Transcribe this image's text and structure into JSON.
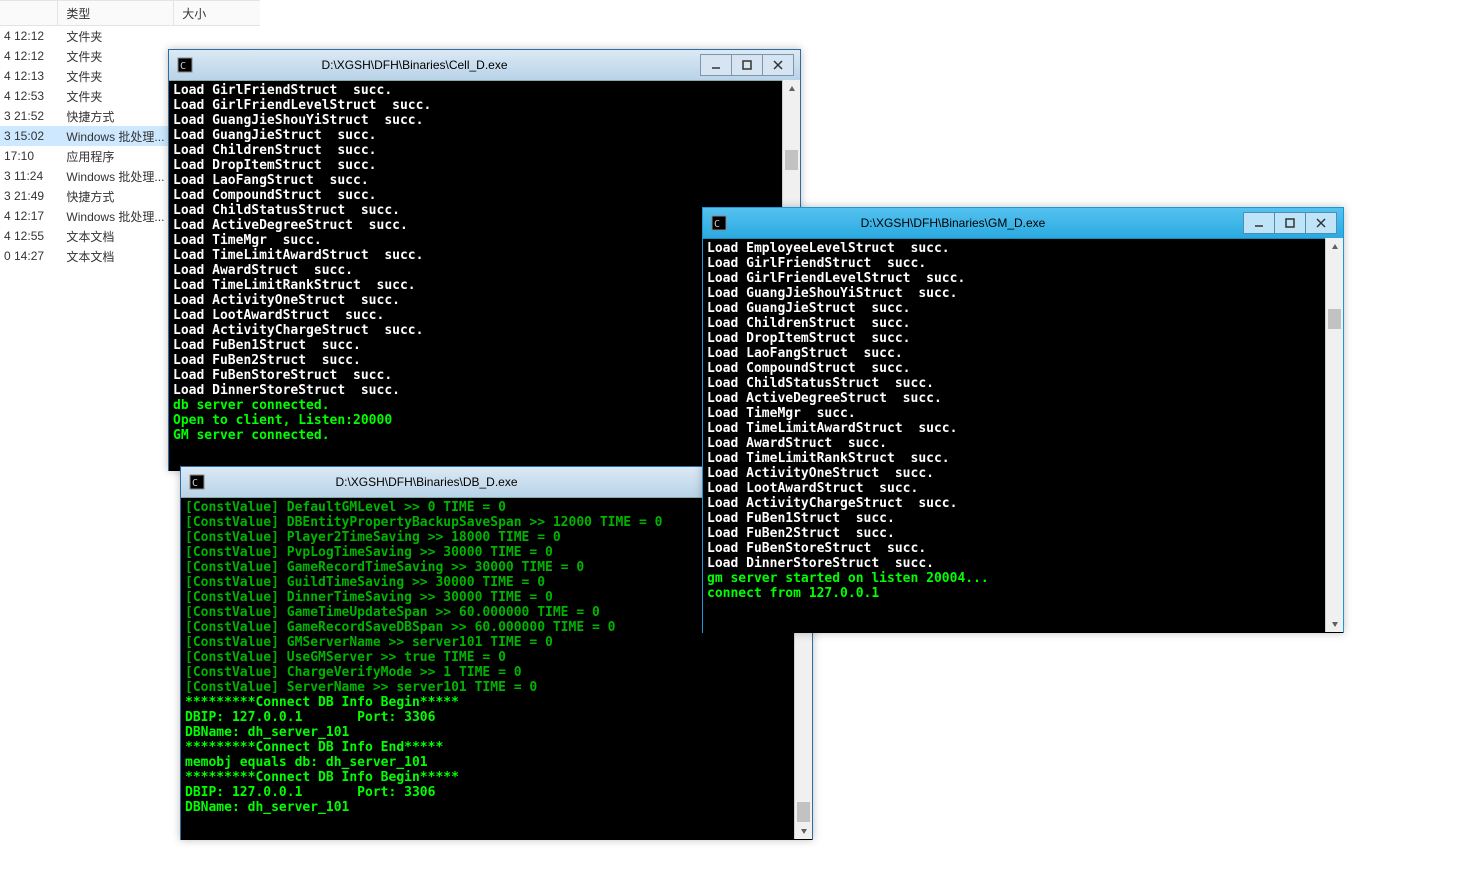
{
  "filepane": {
    "headers": {
      "type": "类型",
      "size": "大小"
    },
    "rows": [
      {
        "date": "4 12:12",
        "type": "文件夹"
      },
      {
        "date": "4 12:12",
        "type": "文件夹"
      },
      {
        "date": "4 12:13",
        "type": "文件夹"
      },
      {
        "date": "4 12:53",
        "type": "文件夹"
      },
      {
        "date": "3 21:52",
        "type": "快捷方式"
      },
      {
        "date": "3 15:02",
        "type": "Windows 批处理...",
        "selected": true
      },
      {
        "date": "17:10",
        "type": "应用程序"
      },
      {
        "date": "3 11:24",
        "type": "Windows 批处理..."
      },
      {
        "date": "3 21:49",
        "type": "快捷方式"
      },
      {
        "date": "4 12:17",
        "type": "Windows 批处理..."
      },
      {
        "date": "4 12:55",
        "type": "文本文档"
      },
      {
        "date": "0 14:27",
        "type": "文本文档"
      }
    ]
  },
  "windows": {
    "cell": {
      "title": "D:\\XGSH\\DFH\\Binaries\\Cell_D.exe",
      "lines": [
        {
          "c": "white",
          "t": "Load GirlFriendStruct  succ."
        },
        {
          "c": "white",
          "t": "Load GirlFriendLevelStruct  succ."
        },
        {
          "c": "white",
          "t": "Load GuangJieShouYiStruct  succ."
        },
        {
          "c": "white",
          "t": "Load GuangJieStruct  succ."
        },
        {
          "c": "white",
          "t": "Load ChildrenStruct  succ."
        },
        {
          "c": "white",
          "t": "Load DropItemStruct  succ."
        },
        {
          "c": "white",
          "t": "Load LaoFangStruct  succ."
        },
        {
          "c": "white",
          "t": "Load CompoundStruct  succ."
        },
        {
          "c": "white",
          "t": "Load ChildStatusStruct  succ."
        },
        {
          "c": "white",
          "t": "Load ActiveDegreeStruct  succ."
        },
        {
          "c": "white",
          "t": "Load TimeMgr  succ."
        },
        {
          "c": "white",
          "t": "Load TimeLimitAwardStruct  succ."
        },
        {
          "c": "white",
          "t": "Load AwardStruct  succ."
        },
        {
          "c": "white",
          "t": "Load TimeLimitRankStruct  succ."
        },
        {
          "c": "white",
          "t": "Load ActivityOneStruct  succ."
        },
        {
          "c": "white",
          "t": "Load LootAwardStruct  succ."
        },
        {
          "c": "white",
          "t": "Load ActivityChargeStruct  succ."
        },
        {
          "c": "white",
          "t": "Load FuBen1Struct  succ."
        },
        {
          "c": "white",
          "t": "Load FuBen2Struct  succ."
        },
        {
          "c": "white",
          "t": "Load FuBenStoreStruct  succ."
        },
        {
          "c": "white",
          "t": "Load DinnerStoreStruct  succ."
        },
        {
          "c": "green",
          "t": "db server connected."
        },
        {
          "c": "green",
          "t": "Open to client, Listen:20000"
        },
        {
          "c": "green",
          "t": "GM server connected."
        }
      ]
    },
    "db": {
      "title": "D:\\XGSH\\DFH\\Binaries\\DB_D.exe",
      "lines": [
        {
          "c": "greend",
          "t": "[ConstValue] DefaultGMLevel >> 0 TIME = 0"
        },
        {
          "c": "greend",
          "t": "[ConstValue] DBEntityPropertyBackupSaveSpan >> 12000 TIME = 0"
        },
        {
          "c": "greend",
          "t": "[ConstValue] Player2TimeSaving >> 18000 TIME = 0"
        },
        {
          "c": "greend",
          "t": "[ConstValue] PvpLogTimeSaving >> 30000 TIME = 0"
        },
        {
          "c": "greend",
          "t": "[ConstValue] GameRecordTimeSaving >> 30000 TIME = 0"
        },
        {
          "c": "greend",
          "t": "[ConstValue] GuildTimeSaving >> 30000 TIME = 0"
        },
        {
          "c": "greend",
          "t": "[ConstValue] DinnerTimeSaving >> 30000 TIME = 0"
        },
        {
          "c": "greend",
          "t": "[ConstValue] GameTimeUpdateSpan >> 60.000000 TIME = 0"
        },
        {
          "c": "greend",
          "t": "[ConstValue] GameRecordSaveDBSpan >> 60.000000 TIME = 0"
        },
        {
          "c": "greend",
          "t": "[ConstValue] GMServerName >> server101 TIME = 0"
        },
        {
          "c": "greend",
          "t": "[ConstValue] UseGMServer >> true TIME = 0"
        },
        {
          "c": "greend",
          "t": "[ConstValue] ChargeVerifyMode >> 1 TIME = 0"
        },
        {
          "c": "greend",
          "t": "[ConstValue] ServerName >> server101 TIME = 0"
        },
        {
          "c": "green",
          "t": "*********Connect DB Info Begin*****"
        },
        {
          "c": "green",
          "t": "DBIP: 127.0.0.1       Port: 3306"
        },
        {
          "c": "green",
          "t": "DBName: dh_server_101"
        },
        {
          "c": "green",
          "t": ""
        },
        {
          "c": "green",
          "t": "*********Connect DB Info End*****"
        },
        {
          "c": "green",
          "t": "memobj equals db: dh_server_101"
        },
        {
          "c": "green",
          "t": "*********Connect DB Info Begin*****"
        },
        {
          "c": "green",
          "t": "DBIP: 127.0.0.1       Port: 3306"
        },
        {
          "c": "green",
          "t": "DBName: dh_server_101"
        }
      ]
    },
    "gm": {
      "title": "D:\\XGSH\\DFH\\Binaries\\GM_D.exe",
      "lines": [
        {
          "c": "white",
          "t": "Load EmployeeLevelStruct  succ."
        },
        {
          "c": "white",
          "t": "Load GirlFriendStruct  succ."
        },
        {
          "c": "white",
          "t": "Load GirlFriendLevelStruct  succ."
        },
        {
          "c": "white",
          "t": "Load GuangJieShouYiStruct  succ."
        },
        {
          "c": "white",
          "t": "Load GuangJieStruct  succ."
        },
        {
          "c": "white",
          "t": "Load ChildrenStruct  succ."
        },
        {
          "c": "white",
          "t": "Load DropItemStruct  succ."
        },
        {
          "c": "white",
          "t": "Load LaoFangStruct  succ."
        },
        {
          "c": "white",
          "t": "Load CompoundStruct  succ."
        },
        {
          "c": "white",
          "t": "Load ChildStatusStruct  succ."
        },
        {
          "c": "white",
          "t": "Load ActiveDegreeStruct  succ."
        },
        {
          "c": "white",
          "t": "Load TimeMgr  succ."
        },
        {
          "c": "white",
          "t": "Load TimeLimitAwardStruct  succ."
        },
        {
          "c": "white",
          "t": "Load AwardStruct  succ."
        },
        {
          "c": "white",
          "t": "Load TimeLimitRankStruct  succ."
        },
        {
          "c": "white",
          "t": "Load ActivityOneStruct  succ."
        },
        {
          "c": "white",
          "t": "Load LootAwardStruct  succ."
        },
        {
          "c": "white",
          "t": "Load ActivityChargeStruct  succ."
        },
        {
          "c": "white",
          "t": "Load FuBen1Struct  succ."
        },
        {
          "c": "white",
          "t": "Load FuBen2Struct  succ."
        },
        {
          "c": "white",
          "t": "Load FuBenStoreStruct  succ."
        },
        {
          "c": "white",
          "t": "Load DinnerStoreStruct  succ."
        },
        {
          "c": "green",
          "t": "gm server started on listen 20004..."
        },
        {
          "c": "green",
          "t": "connect from 127.0.0.1"
        }
      ]
    }
  }
}
